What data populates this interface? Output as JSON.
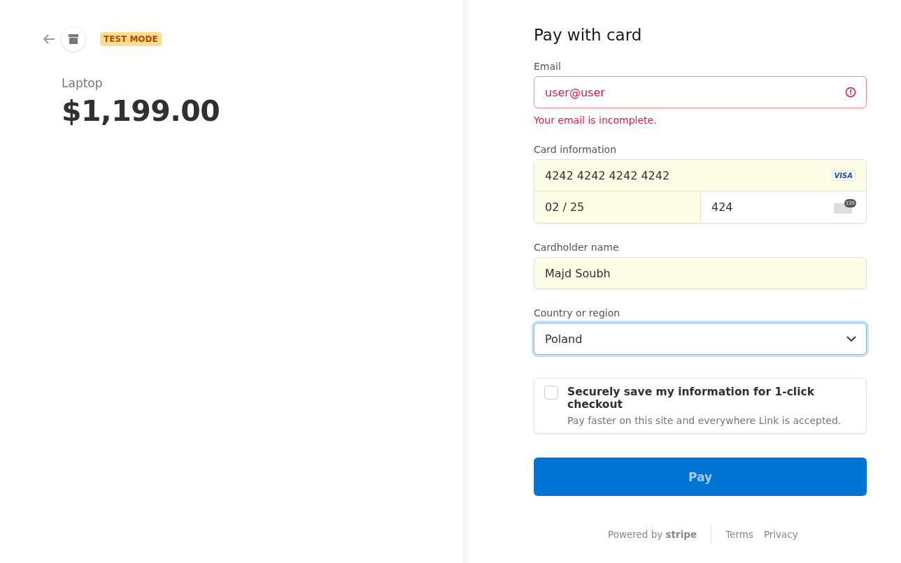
{
  "header": {
    "badge": "TEST MODE"
  },
  "product": {
    "name": "Laptop",
    "price": "$1,199.00"
  },
  "form": {
    "title": "Pay with card",
    "email": {
      "label": "Email",
      "value": "user@user",
      "error": true,
      "error_text": "Your email is incomplete."
    },
    "card": {
      "label": "Card information",
      "number": "4242 4242 4242 4242",
      "brand": "VISA",
      "expiry": "02 / 25",
      "cvc": "424",
      "cvc_icon_text": "135",
      "autofilled": true
    },
    "cardholder": {
      "label": "Cardholder name",
      "value": "Majd Soubh",
      "autofilled": true
    },
    "country": {
      "label": "Country or region",
      "value": "Poland",
      "focused": true
    },
    "save": {
      "checked": false,
      "title": "Securely save my information for 1-click checkout",
      "subtitle": "Pay faster on this site and everywhere Link is accepted."
    },
    "pay_button": {
      "label": "Pay",
      "disabled": true
    }
  },
  "footer": {
    "powered": "Powered by **stripe**",
    "links": [
      "Terms",
      "Privacy"
    ]
  }
}
